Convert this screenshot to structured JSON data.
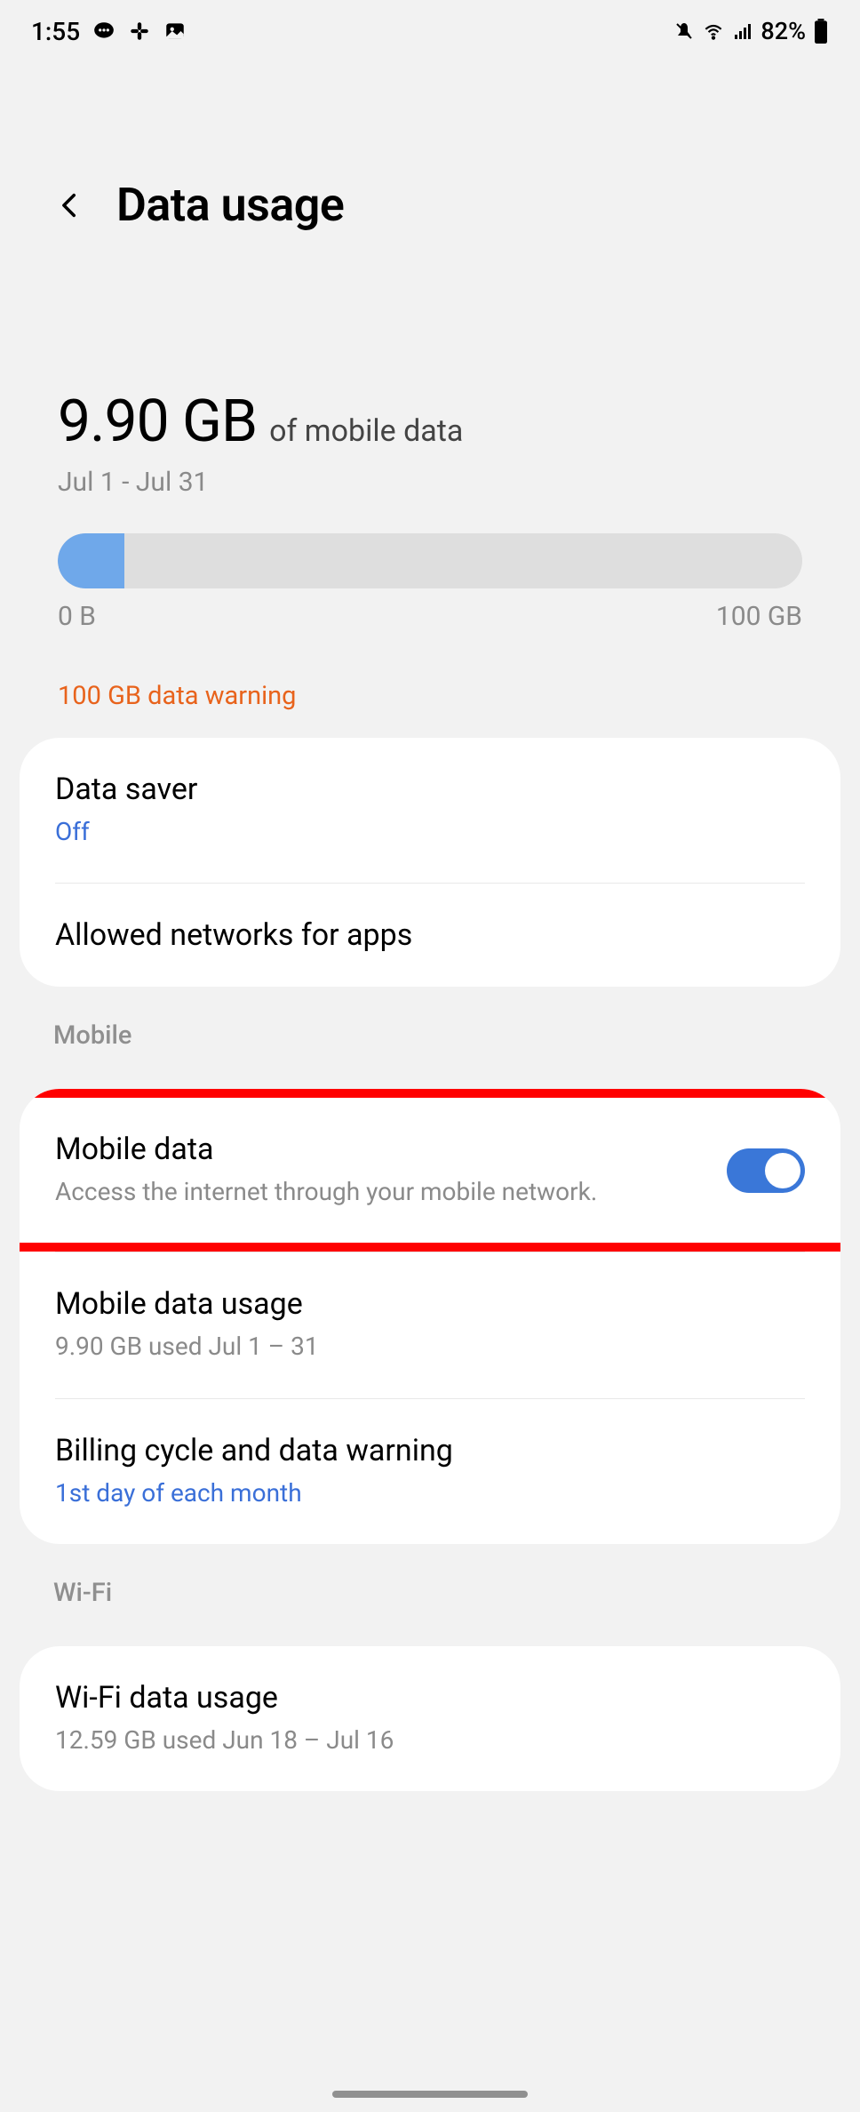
{
  "status": {
    "time": "1:55",
    "battery": "82%"
  },
  "header": {
    "title": "Data usage"
  },
  "summary": {
    "amount": "9.90 GB",
    "suffix": "of mobile data",
    "range": "Jul 1 - Jul 31",
    "progress_min": "0 B",
    "progress_max": "100 GB",
    "progress_fill_percent": 9,
    "warning": "100 GB data warning"
  },
  "rows": {
    "data_saver": {
      "title": "Data saver",
      "sub": "Off"
    },
    "allowed_networks": {
      "title": "Allowed networks for apps"
    },
    "mobile_header": "Mobile",
    "mobile_data": {
      "title": "Mobile data",
      "sub": "Access the internet through your mobile network.",
      "toggle_on": true
    },
    "mobile_usage": {
      "title": "Mobile data usage",
      "sub": "9.90 GB used Jul 1 – 31"
    },
    "billing": {
      "title": "Billing cycle and data warning",
      "sub": "1st day of each month"
    },
    "wifi_header": "Wi-Fi",
    "wifi_usage": {
      "title": "Wi-Fi data usage",
      "sub": "12.59 GB used Jun 18 – Jul 16"
    }
  }
}
